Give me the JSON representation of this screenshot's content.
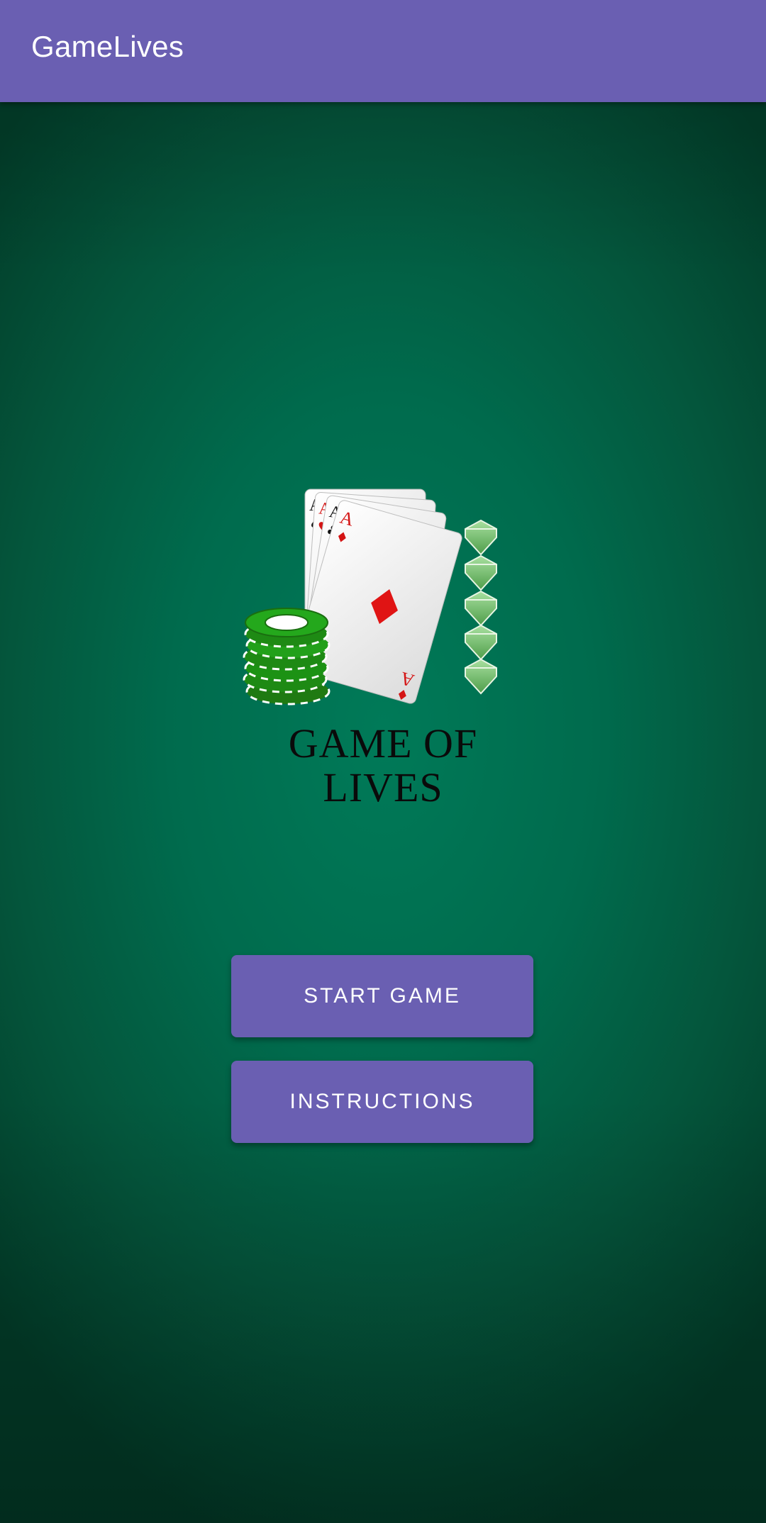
{
  "app_bar": {
    "title": "GameLives",
    "color": "#6a5fb2"
  },
  "logo": {
    "title_line1": "GAME OF",
    "title_line2": "LIVES",
    "icons": [
      "playing-cards-aces",
      "poker-chips-stack",
      "green-gems"
    ]
  },
  "buttons": {
    "start_game": "START GAME",
    "instructions": "INSTRUCTIONS"
  },
  "colors": {
    "felt_green": "#006b4d",
    "accent_purple": "#6a5fb2",
    "button_text": "#ffffff"
  }
}
